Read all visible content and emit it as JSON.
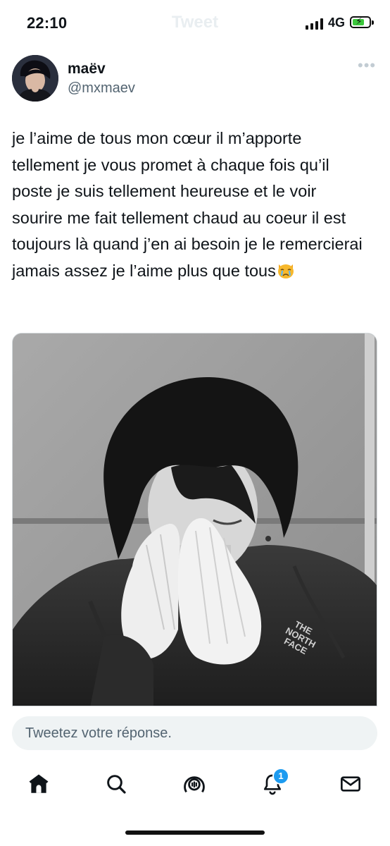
{
  "status_bar": {
    "time": "22:10",
    "network": "4G",
    "battery_color": "#3cc73c"
  },
  "nav": {
    "title": "Tweet"
  },
  "tweet": {
    "author_name": "maëv",
    "author_handle": "@mxmaev",
    "text": "je l’aime de tous mon cœur il m’apporte tellement je vous promet à chaque fois qu’il poste je suis tellement heureuse et le voir sourire me fait tellement chaud au coeur il est toujours là quand j’en ai besoin je le remercierai jamais assez je l’aime plus que tous",
    "emoji": "crying-cat-face",
    "more_icon": "ellipsis-icon",
    "jacket_text": [
      "THE",
      "NORTH",
      "FACE"
    ]
  },
  "reply": {
    "placeholder": "Tweetez votre réponse."
  },
  "tabbar": {
    "items": [
      "home-icon",
      "search-icon",
      "spaces-icon",
      "notifications-icon",
      "messages-icon"
    ],
    "notifications_badge": "1",
    "accent": "#1d9bf0"
  }
}
